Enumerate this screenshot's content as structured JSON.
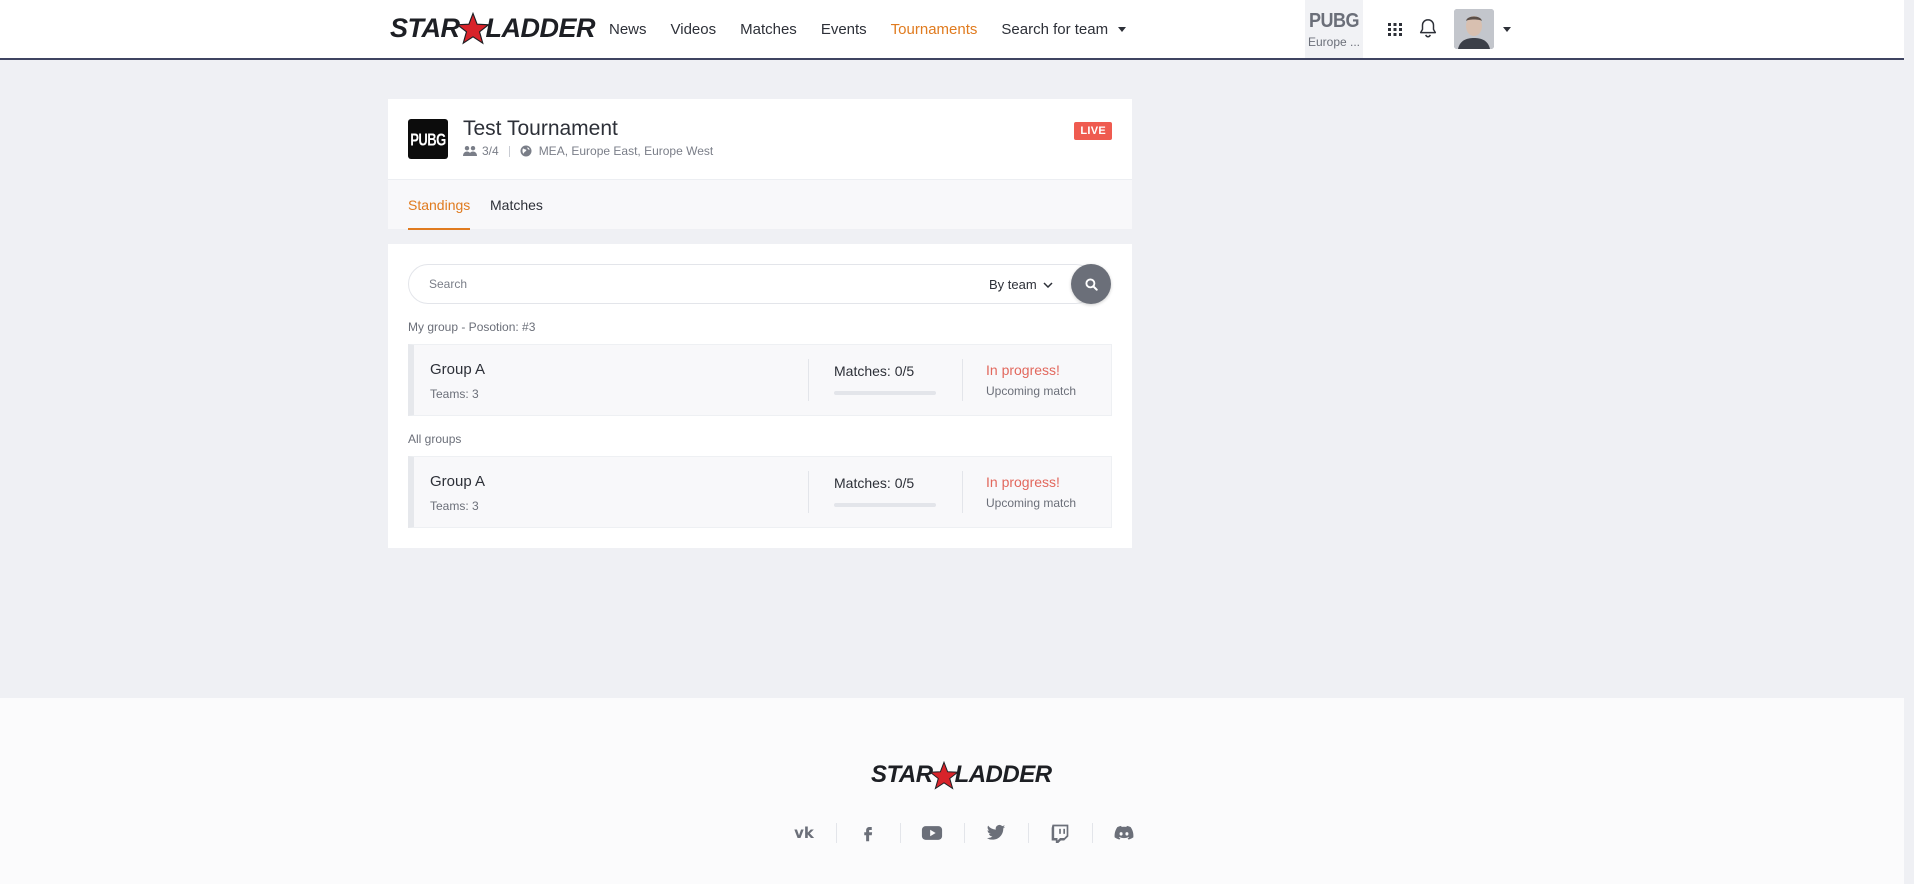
{
  "header": {
    "logo_left": "STAR",
    "logo_right": "LADDER",
    "nav": [
      {
        "label": "News"
      },
      {
        "label": "Videos"
      },
      {
        "label": "Matches"
      },
      {
        "label": "Events"
      },
      {
        "label": "Tournaments",
        "active": true
      },
      {
        "label": "Search for team"
      }
    ],
    "game": {
      "logo": "PUBG",
      "region": "Europe ..."
    },
    "icons": [
      "apps-grid-icon",
      "bell-icon",
      "user-avatar"
    ]
  },
  "tournament": {
    "game_badge": "PUBG",
    "title": "Test Tournament",
    "teams": "3/4",
    "regions": "MEA, Europe East, Europe West",
    "status": "LIVE",
    "tabs": [
      {
        "label": "Standings",
        "active": true
      },
      {
        "label": "Matches"
      }
    ]
  },
  "standings": {
    "search_placeholder": "Search",
    "filter_label": "By team",
    "my_group_label": "My group - Posotion: #3",
    "all_groups_label": "All groups",
    "my_group": {
      "name": "Group A",
      "teams": "Teams: 3",
      "matches": "Matches: 0/5",
      "progress": 0,
      "status": "In progress!",
      "next": "Upcoming match"
    },
    "all_groups": [
      {
        "name": "Group A",
        "teams": "Teams: 3",
        "matches": "Matches: 0/5",
        "progress": 0,
        "status": "In progress!",
        "next": "Upcoming match"
      }
    ]
  },
  "footer": {
    "logo_left": "STAR",
    "logo_right": "LADDER",
    "socials": [
      "vk-icon",
      "facebook-icon",
      "youtube-icon",
      "twitter-icon",
      "twitch-icon",
      "discord-icon"
    ],
    "vk_glyph": "vk"
  },
  "colors": {
    "accent": "#e07b1f",
    "live": "#ef5b50",
    "status": "#e2685d",
    "star": "#d8232a"
  }
}
